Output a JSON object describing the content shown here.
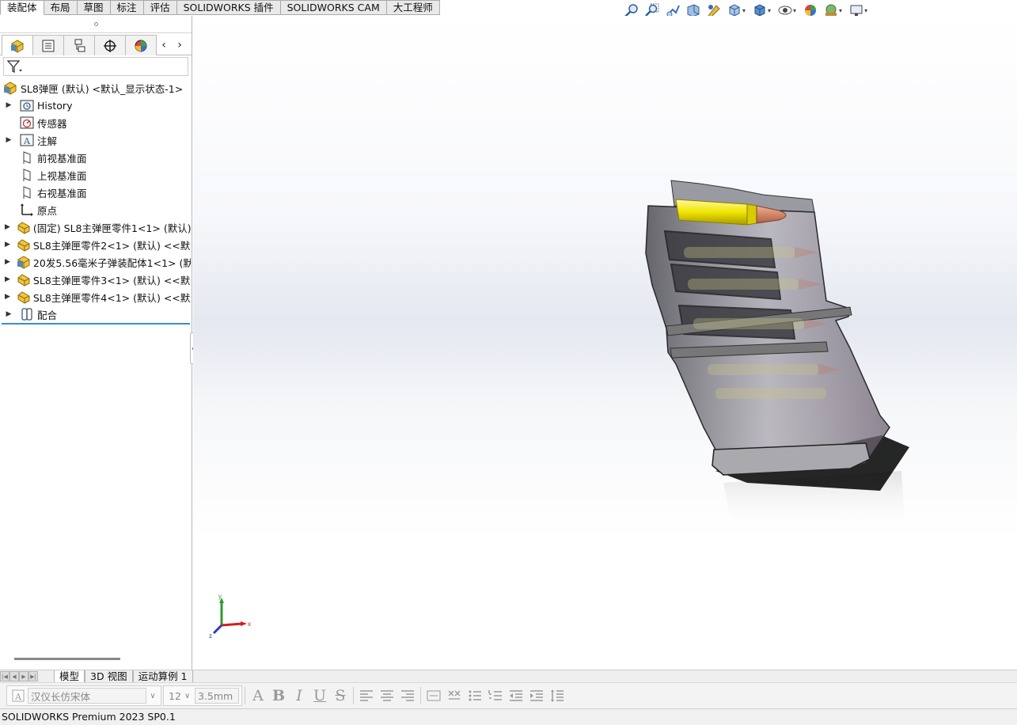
{
  "command_tabs": [
    "装配体",
    "布局",
    "草图",
    "标注",
    "评估",
    "SOLIDWORKS 插件",
    "SOLIDWORKS CAM",
    "大工程师"
  ],
  "heads_up_toolbar": [
    "zoom-to-fit-icon",
    "zoom-to-area-icon",
    "previous-view-icon",
    "section-view-icon",
    "dynamic-annotation-icon",
    "view-orientation-icon",
    "display-style-icon",
    "hide-show-items-icon",
    "edit-appearance-icon",
    "apply-scene-icon",
    "view-settings-icon"
  ],
  "feature_manager": {
    "tabs": [
      "feature-manager-icon",
      "property-manager-icon",
      "configuration-manager-icon",
      "dimxpert-manager-icon",
      "display-manager-icon"
    ],
    "tree": {
      "root": "SL8弹匣 (默认) <默认_显示状态-1>",
      "items": [
        {
          "label": "History",
          "icon": "history-folder-icon",
          "expandable": true
        },
        {
          "label": "传感器",
          "icon": "sensor-icon",
          "expandable": false
        },
        {
          "label": "注解",
          "icon": "annotation-icon",
          "expandable": true
        },
        {
          "label": "前视基准面",
          "icon": "plane-icon",
          "expandable": false
        },
        {
          "label": "上视基准面",
          "icon": "plane-icon",
          "expandable": false
        },
        {
          "label": "右视基准面",
          "icon": "plane-icon",
          "expandable": false
        },
        {
          "label": "原点",
          "icon": "origin-icon",
          "expandable": false
        },
        {
          "label": "(固定) SL8主弹匣零件1<1> (默认)",
          "icon": "part-icon",
          "expandable": true
        },
        {
          "label": "SL8主弹匣零件2<1> (默认) <<默认",
          "icon": "part-icon",
          "expandable": true
        },
        {
          "label": "20发5.56毫米子弹装配体1<1> (默认",
          "icon": "subassembly-icon",
          "expandable": true
        },
        {
          "label": "SL8主弹匣零件3<1> (默认) <<默认",
          "icon": "part-icon",
          "expandable": true
        },
        {
          "label": "SL8主弹匣零件4<1> (默认) <<默认",
          "icon": "part-icon",
          "expandable": true
        },
        {
          "label": "配合",
          "icon": "mates-icon",
          "expandable": true
        }
      ]
    }
  },
  "bottom_tabs": [
    "模型",
    "3D 视图",
    "运动算例 1"
  ],
  "format_toolbar": {
    "font": "汉仪长仿宋体",
    "size": "12",
    "height": "3.5mm"
  },
  "status_bar": "SOLIDWORKS Premium 2023 SP0.1",
  "triad_labels": {
    "x": "x",
    "y": "y",
    "z": "z"
  },
  "colors": {
    "accent_blue": "#3b8bd6",
    "bullet_yellow": "#f0e600",
    "bullet_tip": "#d98a6a",
    "magazine_gray": "#5a5a60"
  }
}
